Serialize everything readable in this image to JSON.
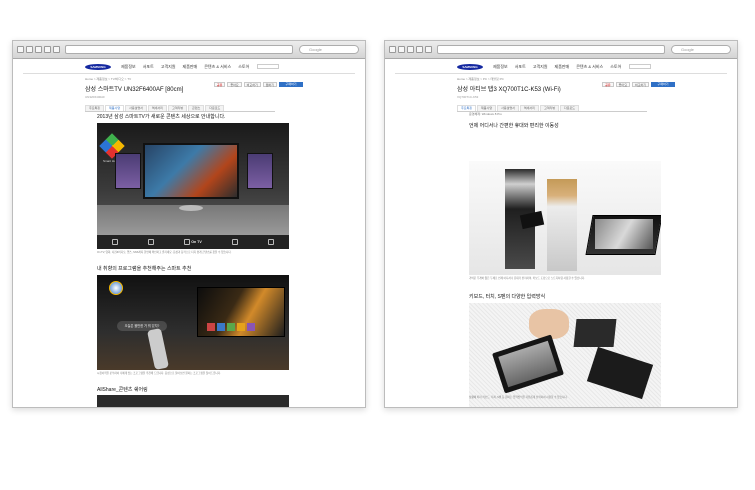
{
  "windows": [
    {
      "search_placeholder": "Google",
      "logo": "SAMSUNG",
      "nav": [
        "제품정보",
        "서포트",
        "고객지원",
        "제품판매",
        "콘텐츠 & 서비스",
        "스토어"
      ],
      "breadcrumb": "Home > 제품정보 > TV/비디오 > TV",
      "title": "삼성 스마트TV UN32F6400AF [80cm]",
      "model": "UN32F6400AF",
      "buy_pills": [
        "공유",
        "좋아요",
        "비교하기",
        "찜하기"
      ],
      "buy_label": "구매하기",
      "tabs": [
        "주요특징",
        "제품사양",
        "사용설명서",
        "액세서리",
        "고객리뷰",
        "콘텐츠",
        "다운로드"
      ],
      "section1": "2013년 삼성 스마트TV가 새로운 콘텐츠 세상으로 안내합니다.",
      "hub_label": "Smart Hub",
      "icons": [
        "On TV"
      ],
      "caption1": "On TV, 영화, 사진&비디오, 앱스, SNS까지 한번에 확인하고 즐기세요. 음성과 동작으로 더욱 쉽게 콘텐츠를 찾을 수 있습니다.",
      "section2": "내 취향의 프로그램을 추천해주는 스마트 추천",
      "bubble": "오늘은 볼만한 거 뭐 있지?",
      "caption2": "시청이력을 분석하여 나에게 맞는 프로그램을 추천해 드립니다. 음성으로 물어보면 원하는 프로그램을 찾아드립니다.",
      "section3": "AllShare_콘텐츠 쉐어링"
    },
    {
      "search_placeholder": "Google",
      "logo": "SAMSUNG",
      "nav": [
        "제품정보",
        "서포트",
        "고객지원",
        "제품판매",
        "콘텐츠 & 서비스",
        "스토어"
      ],
      "breadcrumb": "Home > 제품정보 > PC > 태블릿 PC",
      "title": "삼성 아티브 탭3 XQ700T1C-K53 (Wi-Fi)",
      "model": "XQ700T1C-K53",
      "buy_pills": [
        "공유",
        "좋아요",
        "비교하기"
      ],
      "buy_label": "구매하기",
      "tabs": [
        "주요특징",
        "제품사양",
        "사용설명서",
        "액세서리",
        "고객리뷰",
        "다운로드"
      ],
      "os_line": "운영체제: Windows 8 Pro",
      "section1": "언제 어디서나 간편한 휴대와 편리한 이동성",
      "caption1": "가벼운 무게와 얇은 두께로 언제 어디서나 휴대가 편리하며, 키보드 도킹으로 노트북처럼 사용할 수 있습니다.",
      "section2": "키보드, 터치, S펜의 다양한 입력방식",
      "caption2": "상황에 따라 키보드, 터치, S펜 등 원하는 입력방식을 자유롭게 선택하여 사용할 수 있습니다."
    }
  ]
}
